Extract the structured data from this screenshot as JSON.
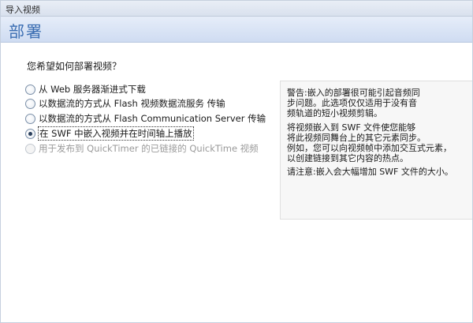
{
  "window": {
    "title": "导入视频"
  },
  "header": {
    "title": "部署"
  },
  "main": {
    "question": "您希望如何部署视频？",
    "options": [
      {
        "label": "从 Web 服务器渐进式下载",
        "checked": false,
        "enabled": true
      },
      {
        "label": "以数据流的方式从 Flash 视频数据流服务 传输",
        "checked": false,
        "enabled": true
      },
      {
        "label": "以数据流的方式从 Flash Communication Server 传输",
        "checked": false,
        "enabled": true
      },
      {
        "label": "在 SWF 中嵌入视频并在时间轴上播放",
        "checked": true,
        "enabled": true
      },
      {
        "label": "用于发布到 QuickTimer 的已链接的 QuickTime 视频",
        "checked": false,
        "enabled": false
      }
    ]
  },
  "info": {
    "warning_line1": "警告:嵌入的部署很可能引起音频同",
    "warning_line2": "步问题。此选项仅仅适用于没有音",
    "warning_line3": "频轨道的短小视频剪辑。",
    "desc_line1": "将视频嵌入到 SWF 文件使您能够",
    "desc_line2": "将此视频同舞台上的其它元素同步。",
    "desc_line3": "例如，您可以向视频帧中添加交互式元素，",
    "desc_line4": "以创建链接到其它内容的热点。",
    "note": "请注意:嵌入会大幅增加 SWF 文件的大小。"
  }
}
